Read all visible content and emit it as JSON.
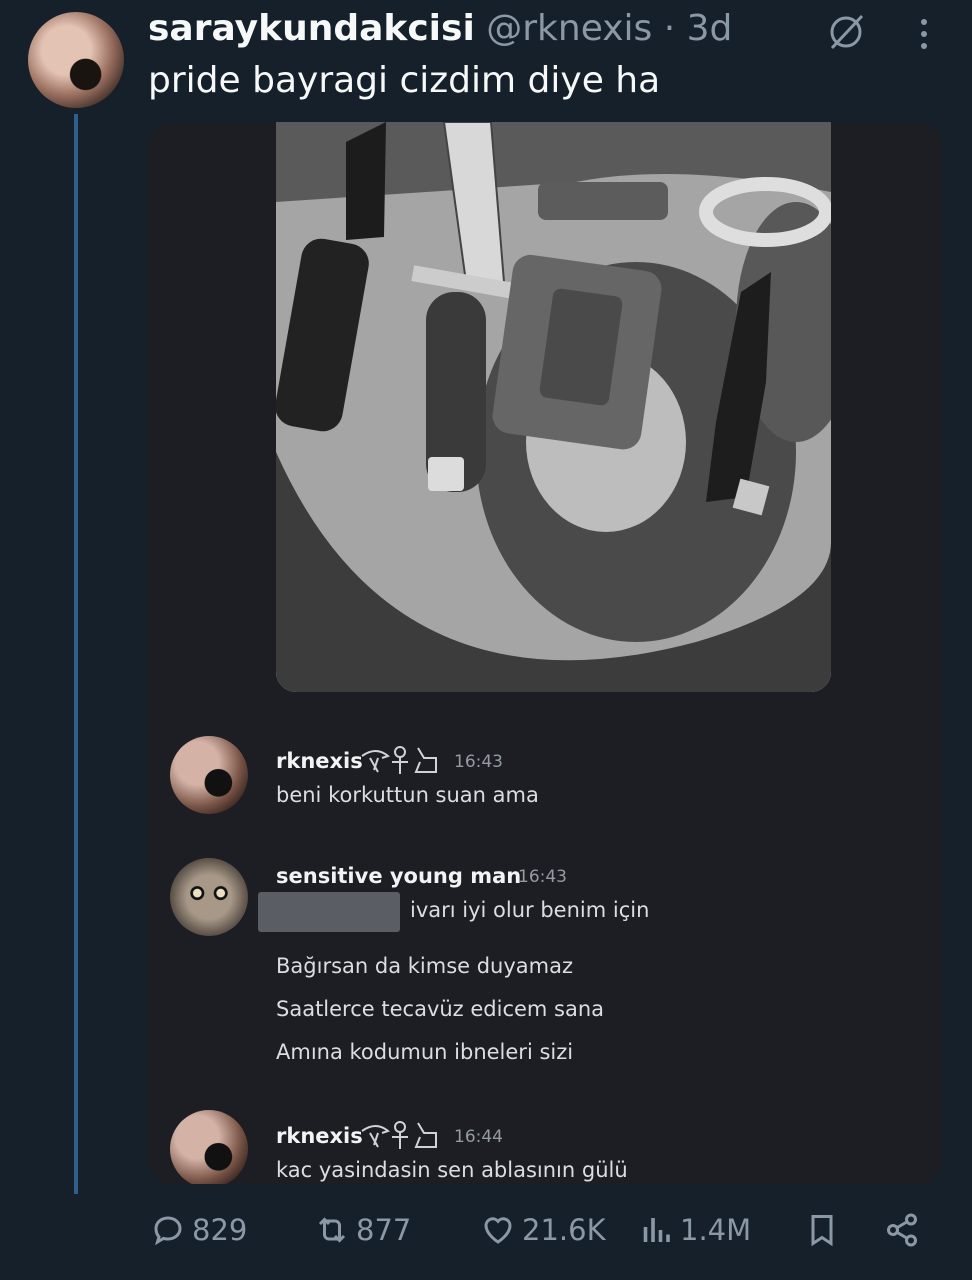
{
  "tweet": {
    "display_name": "saraykundakcisi",
    "handle": "@rknexis",
    "time": "· 3d",
    "text": "pride bayragi cizdim diye ha"
  },
  "chat": [
    {
      "user": "rknexis",
      "time": "16:43",
      "lines": [
        "beni korkuttun suan ama"
      ]
    },
    {
      "user": "sensitive young man",
      "time": "16:43",
      "lines": [
        "ivarı iyi olur benim için",
        "Bağırsan da kimse duyamaz",
        "Saatlerce tecavüz edicem sana",
        "Amına kodumun ibneleri sizi"
      ]
    },
    {
      "user": "rknexis",
      "time": "16:44",
      "lines": [
        "kac yasindasin sen ablasının gülü"
      ]
    }
  ],
  "metrics": {
    "replies": "829",
    "reposts": "877",
    "likes": "21.6K",
    "views": "1.4M"
  },
  "colors": {
    "background": "#15202b",
    "thread_line": "#2f5f8a",
    "muted": "#8b98a5",
    "chat_bg": "#1c1e23"
  },
  "icons": [
    "grok-icon",
    "more-icon",
    "reply-icon",
    "repost-icon",
    "like-icon",
    "views-icon",
    "bookmark-icon",
    "share-icon"
  ]
}
